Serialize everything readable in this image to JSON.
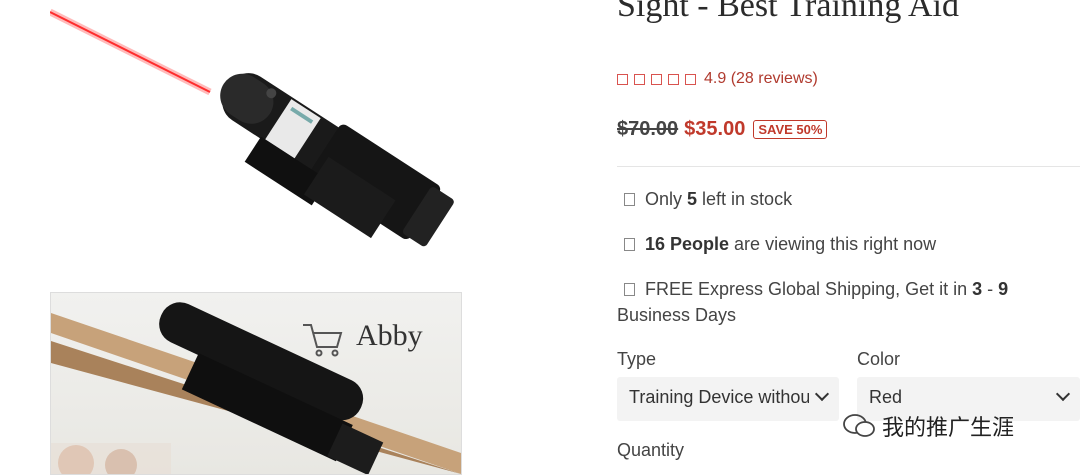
{
  "product": {
    "title": "Sight - Best Training Aid",
    "rating_text": "4.9 (28 reviews)",
    "star_count": 5,
    "old_price": "$70.00",
    "new_price": "$35.00",
    "save_badge": "SAVE 50%"
  },
  "info": {
    "stock_pre": "Only ",
    "stock_num": "5",
    "stock_post": " left in stock",
    "viewing_bold": "16 People",
    "viewing_post": " are viewing this right now",
    "ship_pre": "FREE Express Global Shipping, Get it in ",
    "ship_a": "3",
    "ship_mid": " - ",
    "ship_b": "9",
    "ship_post": "Business Days"
  },
  "options": {
    "type_label": "Type",
    "type_value": "Training Device without",
    "color_label": "Color",
    "color_value": "Red",
    "quantity_label": "Quantity"
  },
  "images": {
    "box_brand": "Abby"
  },
  "watermark": "我的推广生涯",
  "colors": {
    "accent": "#c0392b",
    "laser": "#ff3b3b"
  }
}
